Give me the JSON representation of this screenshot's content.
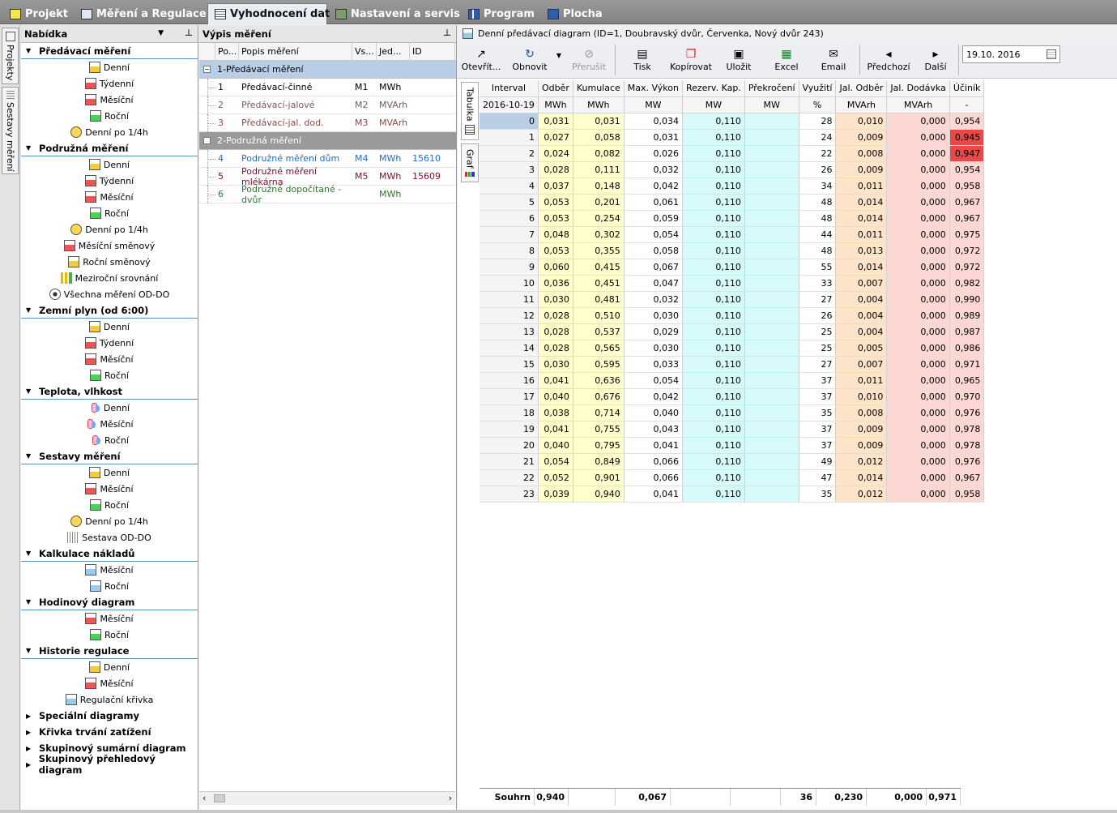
{
  "top_tabs": [
    {
      "label": "Projekt",
      "icon": "folder-icon"
    },
    {
      "label": "Měření a Regulace",
      "icon": "mar-icon"
    },
    {
      "label": "Vyhodnocení dat",
      "icon": "grid-icon"
    },
    {
      "label": "Nastavení a servis",
      "icon": "tools-icon"
    },
    {
      "label": "Program",
      "icon": "chart-icon"
    },
    {
      "label": "Plocha",
      "icon": "desktop-icon"
    }
  ],
  "side_tabs": [
    "Projekty",
    "Sestavy měření"
  ],
  "nav": {
    "title": "Nabídka",
    "sections": [
      {
        "label": "Předávací měření",
        "open": true,
        "items": [
          {
            "label": "Denní",
            "icon": "day-icon"
          },
          {
            "label": "Týdenní",
            "icon": "week-icon"
          },
          {
            "label": "Měsíční",
            "icon": "month-icon"
          },
          {
            "label": "Roční",
            "icon": "year-icon"
          },
          {
            "label": "Denní po 1/4h",
            "icon": "quarter-hour-icon"
          }
        ]
      },
      {
        "label": "Podružná měření",
        "open": true,
        "items": [
          {
            "label": "Denní",
            "icon": "day-icon"
          },
          {
            "label": "Týdenní",
            "icon": "week-icon"
          },
          {
            "label": "Měsíční",
            "icon": "month-icon"
          },
          {
            "label": "Roční",
            "icon": "year-icon"
          },
          {
            "label": "Denní po 1/4h",
            "icon": "quarter-hour-icon"
          },
          {
            "label": "Měsíční směnový",
            "icon": "month-shift-icon"
          },
          {
            "label": "Roční směnový",
            "icon": "year-shift-icon"
          },
          {
            "label": "Meziroční srovnání",
            "icon": "bar-chart-icon"
          },
          {
            "label": "Všechna měření OD-DO",
            "icon": "eye-icon"
          }
        ]
      },
      {
        "label": "Zemní plyn (od 6:00)",
        "open": true,
        "items": [
          {
            "label": "Denní",
            "icon": "day-icon"
          },
          {
            "label": "Týdenní",
            "icon": "week-icon"
          },
          {
            "label": "Měsíční",
            "icon": "month-icon"
          },
          {
            "label": "Roční",
            "icon": "year-icon"
          }
        ]
      },
      {
        "label": "Teplota, vlhkost",
        "open": true,
        "items": [
          {
            "label": "Denní",
            "icon": "thermometer-icon"
          },
          {
            "label": "Měsíční",
            "icon": "thermometer-icon"
          },
          {
            "label": "Roční",
            "icon": "thermometer-icon"
          }
        ]
      },
      {
        "label": "Sestavy měření",
        "open": true,
        "items": [
          {
            "label": "Denní",
            "icon": "day-icon"
          },
          {
            "label": "Měsíční",
            "icon": "month-icon"
          },
          {
            "label": "Roční",
            "icon": "year-icon"
          },
          {
            "label": "Denní po 1/4h",
            "icon": "quarter-hour-icon"
          },
          {
            "label": "Sestava OD-DO",
            "icon": "dots-icon"
          }
        ]
      },
      {
        "label": "Kalkulace nákladů",
        "open": true,
        "items": [
          {
            "label": "Měsíční",
            "icon": "calc-icon"
          },
          {
            "label": "Roční",
            "icon": "calc-icon"
          }
        ]
      },
      {
        "label": "Hodinový diagram",
        "open": true,
        "items": [
          {
            "label": "Měsíční",
            "icon": "month-icon"
          },
          {
            "label": "Roční",
            "icon": "year-icon"
          }
        ]
      },
      {
        "label": "Historie regulace",
        "open": true,
        "items": [
          {
            "label": "Denní",
            "icon": "day-icon"
          },
          {
            "label": "Měsíční",
            "icon": "month-icon"
          },
          {
            "label": "Regulační křivka",
            "icon": "curve-icon"
          }
        ]
      },
      {
        "label": "Speciální diagramy",
        "open": false,
        "items": []
      },
      {
        "label": "Křivka trvání zatížení",
        "open": false,
        "items": []
      },
      {
        "label": "Skupinový sumární diagram",
        "open": false,
        "items": []
      },
      {
        "label": "Skupinový přehledový diagram",
        "open": false,
        "items": []
      }
    ]
  },
  "measurements": {
    "title": "Výpis měření",
    "columns": [
      "Po...",
      "Popis měření",
      "Vs...",
      "Jed...",
      "ID"
    ],
    "groups": [
      {
        "label": "1-Předávací měření",
        "rows": [
          {
            "no": "1",
            "name": "Předávací-činné",
            "vs": "M1",
            "unit": "MWh",
            "id": "",
            "color": "#000000"
          },
          {
            "no": "2",
            "name": "Předávací-jalové",
            "vs": "M2",
            "unit": "MVArh",
            "id": "",
            "color": "#7a5a5a"
          },
          {
            "no": "3",
            "name": "Předávací-jal. dod.",
            "vs": "M3",
            "unit": "MVArh",
            "id": "",
            "color": "#8a4a4a"
          }
        ]
      },
      {
        "label": "2-Podružná měření",
        "rows": [
          {
            "no": "4",
            "name": "Podružné měření dům",
            "vs": "M4",
            "unit": "MWh",
            "id": "15610",
            "color": "#1f6fc5"
          },
          {
            "no": "5",
            "name": "Podružné měření mlékárna",
            "vs": "M5",
            "unit": "MWh",
            "id": "15609",
            "color": "#7a0f2a"
          },
          {
            "no": "6",
            "name": "Podružné dopočítané - dvůr",
            "vs": "",
            "unit": "MWh",
            "id": "",
            "color": "#2a7a2a"
          }
        ]
      }
    ]
  },
  "report": {
    "title": "Denní předávací diagram (ID=1, Doubravský dvůr, Červenka, Nový dvůr 243)",
    "toolbar": [
      "Otevřít...",
      "Obnovit",
      "Přerušit",
      "Tisk",
      "Kopírovat",
      "Uložit",
      "Excel",
      "Email",
      "Předchozí",
      "Další"
    ],
    "date": "19.10. 2016",
    "view_tabs": [
      "Tabulka",
      "Graf"
    ],
    "headers": [
      "Interval",
      "Odběr",
      "Kumulace",
      "Max. Výkon",
      "Rezerv. Kap.",
      "Překročení",
      "Využití",
      "Jal. Odběr",
      "Jal. Dodávka",
      "Účiník"
    ],
    "units": [
      "2016-10-19",
      "MWh",
      "MWh",
      "MW",
      "MW",
      "MW",
      "%",
      "MVArh",
      "MVArh",
      "-"
    ],
    "rows": [
      [
        "0",
        "0,031",
        "0,031",
        "0,034",
        "0,110",
        "",
        "28",
        "0,010",
        "0,000",
        "0,954"
      ],
      [
        "1",
        "0,027",
        "0,058",
        "0,031",
        "0,110",
        "",
        "24",
        "0,009",
        "0,000",
        "0,945"
      ],
      [
        "2",
        "0,024",
        "0,082",
        "0,026",
        "0,110",
        "",
        "22",
        "0,008",
        "0,000",
        "0,947"
      ],
      [
        "3",
        "0,028",
        "0,111",
        "0,032",
        "0,110",
        "",
        "26",
        "0,009",
        "0,000",
        "0,954"
      ],
      [
        "4",
        "0,037",
        "0,148",
        "0,042",
        "0,110",
        "",
        "34",
        "0,011",
        "0,000",
        "0,958"
      ],
      [
        "5",
        "0,053",
        "0,201",
        "0,061",
        "0,110",
        "",
        "48",
        "0,014",
        "0,000",
        "0,967"
      ],
      [
        "6",
        "0,053",
        "0,254",
        "0,059",
        "0,110",
        "",
        "48",
        "0,014",
        "0,000",
        "0,967"
      ],
      [
        "7",
        "0,048",
        "0,302",
        "0,054",
        "0,110",
        "",
        "44",
        "0,011",
        "0,000",
        "0,975"
      ],
      [
        "8",
        "0,053",
        "0,355",
        "0,058",
        "0,110",
        "",
        "48",
        "0,013",
        "0,000",
        "0,972"
      ],
      [
        "9",
        "0,060",
        "0,415",
        "0,067",
        "0,110",
        "",
        "55",
        "0,014",
        "0,000",
        "0,972"
      ],
      [
        "10",
        "0,036",
        "0,451",
        "0,047",
        "0,110",
        "",
        "33",
        "0,007",
        "0,000",
        "0,982"
      ],
      [
        "11",
        "0,030",
        "0,481",
        "0,032",
        "0,110",
        "",
        "27",
        "0,004",
        "0,000",
        "0,990"
      ],
      [
        "12",
        "0,028",
        "0,510",
        "0,030",
        "0,110",
        "",
        "26",
        "0,004",
        "0,000",
        "0,989"
      ],
      [
        "13",
        "0,028",
        "0,537",
        "0,029",
        "0,110",
        "",
        "25",
        "0,004",
        "0,000",
        "0,987"
      ],
      [
        "14",
        "0,028",
        "0,565",
        "0,030",
        "0,110",
        "",
        "25",
        "0,005",
        "0,000",
        "0,986"
      ],
      [
        "15",
        "0,030",
        "0,595",
        "0,033",
        "0,110",
        "",
        "27",
        "0,007",
        "0,000",
        "0,971"
      ],
      [
        "16",
        "0,041",
        "0,636",
        "0,054",
        "0,110",
        "",
        "37",
        "0,011",
        "0,000",
        "0,965"
      ],
      [
        "17",
        "0,040",
        "0,676",
        "0,042",
        "0,110",
        "",
        "37",
        "0,010",
        "0,000",
        "0,970"
      ],
      [
        "18",
        "0,038",
        "0,714",
        "0,040",
        "0,110",
        "",
        "35",
        "0,008",
        "0,000",
        "0,976"
      ],
      [
        "19",
        "0,041",
        "0,755",
        "0,043",
        "0,110",
        "",
        "37",
        "0,009",
        "0,000",
        "0,978"
      ],
      [
        "20",
        "0,040",
        "0,795",
        "0,041",
        "0,110",
        "",
        "37",
        "0,009",
        "0,000",
        "0,978"
      ],
      [
        "21",
        "0,054",
        "0,849",
        "0,066",
        "0,110",
        "",
        "49",
        "0,012",
        "0,000",
        "0,976"
      ],
      [
        "22",
        "0,052",
        "0,901",
        "0,066",
        "0,110",
        "",
        "47",
        "0,014",
        "0,000",
        "0,967"
      ],
      [
        "23",
        "0,039",
        "0,940",
        "0,041",
        "0,110",
        "",
        "35",
        "0,012",
        "0,000",
        "0,958"
      ]
    ],
    "low_pf_rows": [
      "1",
      "2"
    ],
    "summary": [
      "Souhrn",
      "0,940",
      "",
      "0,067",
      "",
      "",
      "36",
      "0,230",
      "0,000",
      "0,971"
    ]
  },
  "colors": {
    "odber": "#ffffcc",
    "rezerv": "#d6fafa",
    "jal_odber": "#fde4c8",
    "jal_dodavka": "#fdd8d3",
    "low_pf": "#e84848",
    "selected": "#b9cde6"
  }
}
